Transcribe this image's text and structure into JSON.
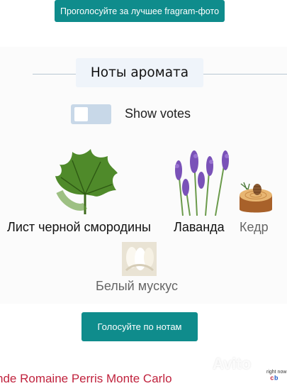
{
  "header": {
    "vote_photo_label": "Проголосуйте за лучшее fragram-фото"
  },
  "notes_section": {
    "title": "Ноты аромата",
    "toggle_label": "Show votes",
    "notes": [
      {
        "name": "Лист черной смородины"
      },
      {
        "name": "Лаванда"
      },
      {
        "name": "Кедр"
      },
      {
        "name": "Белый мускус"
      }
    ],
    "vote_notes_label": "Голосуйте по нотам"
  },
  "footer": {
    "link_text": "nde Romaine Perris Monte Carlo",
    "watermark": "Avito",
    "corner_text": "right now"
  },
  "colors": {
    "accent": "#0f8c8c",
    "link": "#c0223d"
  }
}
